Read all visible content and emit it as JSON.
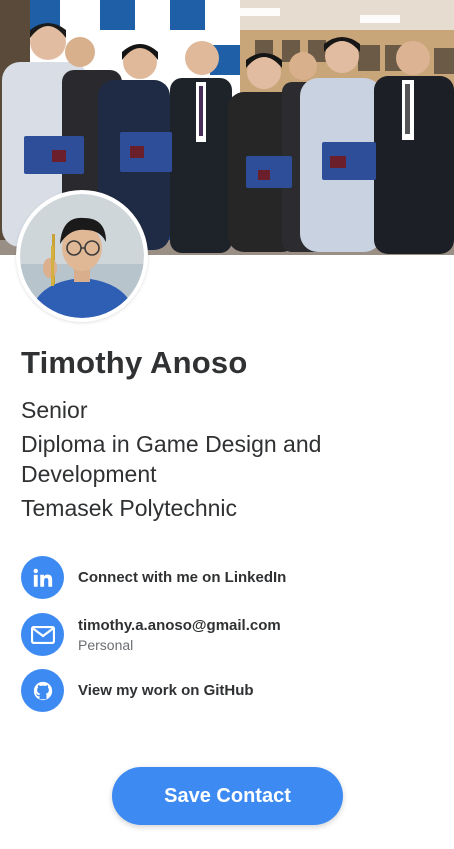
{
  "profile": {
    "name": "Timothy Anoso",
    "info_lines": [
      "Senior",
      "Diploma in Game Design and Development",
      "Temasek Polytechnic"
    ]
  },
  "contacts": [
    {
      "icon": "linkedin-icon",
      "primary": "Connect with me on LinkedIn",
      "secondary": ""
    },
    {
      "icon": "envelope-icon",
      "primary": "timothy.a.anoso@gmail.com",
      "secondary": "Personal"
    },
    {
      "icon": "github-icon",
      "primary": "View my work on GitHub",
      "secondary": ""
    }
  ],
  "actions": {
    "save_label": "Save Contact"
  },
  "colors": {
    "accent": "#3d8bf2",
    "text": "#2f3133",
    "muted": "#6b6f73"
  }
}
